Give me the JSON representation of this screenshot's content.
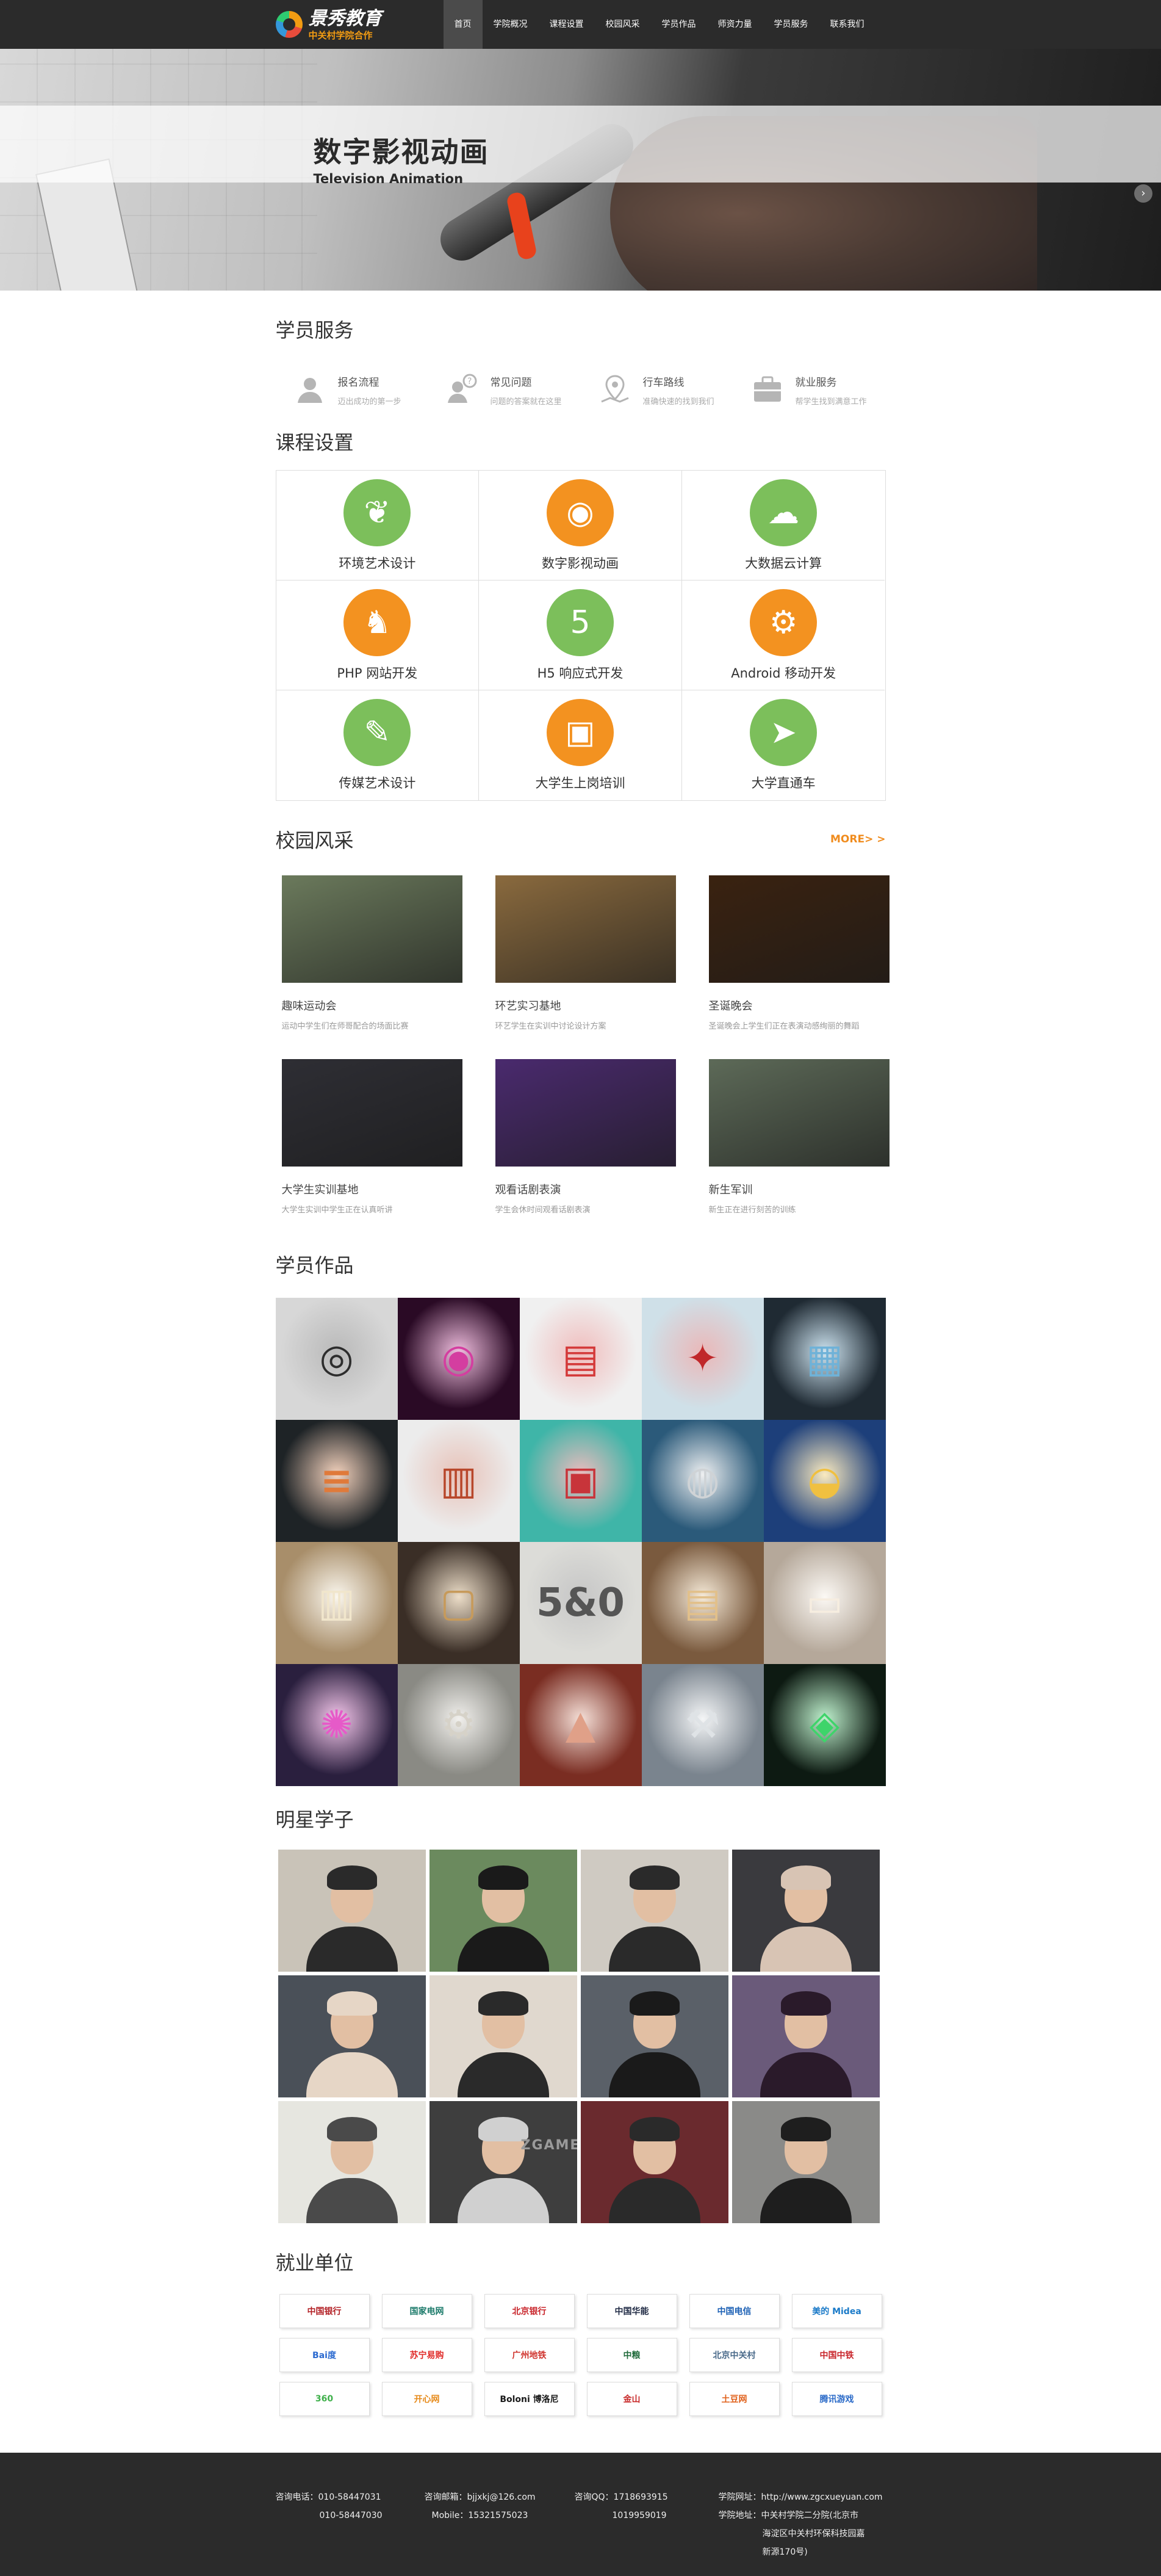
{
  "nav": {
    "logo_main": "景秀教育",
    "logo_sub": "中关村学院合作",
    "items": [
      "首页",
      "学院概况",
      "课程设置",
      "校园风采",
      "学员作品",
      "师资力量",
      "学员服务",
      "联系我们"
    ]
  },
  "banner": {
    "title": "数字影视动画",
    "subtitle": "Television Animation",
    "arrow": "›"
  },
  "services": {
    "title": "学员服务",
    "items": [
      {
        "title": "报名流程",
        "desc": "迈出成功的第一步",
        "icon": "user-icon"
      },
      {
        "title": "常见问题",
        "desc": "问题的答案就在这里",
        "icon": "question-icon"
      },
      {
        "title": "行车路线",
        "desc": "准确快速的找到我们",
        "icon": "map-pin-icon"
      },
      {
        "title": "就业服务",
        "desc": "帮学生找到满意工作",
        "icon": "briefcase-icon"
      }
    ]
  },
  "courses": {
    "title": "课程设置",
    "items": [
      {
        "label": "环境艺术设计",
        "glyph": "❦",
        "color": "#7cbf5b",
        "icon": "sprout-icon"
      },
      {
        "label": "数字影视动画",
        "glyph": "◉",
        "color": "#f39220",
        "icon": "film-reel-icon"
      },
      {
        "label": "大数据云计算",
        "glyph": "☁",
        "color": "#7cbf5b",
        "icon": "cloud-icon"
      },
      {
        "label": "PHP 网站开发",
        "glyph": "♞",
        "color": "#f39220",
        "icon": "elephant-icon"
      },
      {
        "label": "H5 响应式开发",
        "glyph": "5",
        "color": "#7cbf5b",
        "icon": "html5-icon"
      },
      {
        "label": "Android 移动开发",
        "glyph": "⚙",
        "color": "#f39220",
        "icon": "android-icon"
      },
      {
        "label": "传媒艺术设计",
        "glyph": "✎",
        "color": "#7cbf5b",
        "icon": "palette-icon"
      },
      {
        "label": "大学生上岗培训",
        "glyph": "▣",
        "color": "#f39220",
        "icon": "presentation-icon"
      },
      {
        "label": "大学直通车",
        "glyph": "➤",
        "color": "#7cbf5b",
        "icon": "train-icon"
      }
    ]
  },
  "campus": {
    "title": "校园风采",
    "more": "MORE> >",
    "items": [
      {
        "title": "趣味运动会",
        "desc": "运动中学生们在师哥配合的场面比赛",
        "bg": "#6b7a5c"
      },
      {
        "title": "环艺实习基地",
        "desc": "环艺学生在实训中讨论设计方案",
        "bg": "#8a6a3e"
      },
      {
        "title": "圣诞晚会",
        "desc": "圣诞晚会上学生们正在表演动感绚丽的舞蹈",
        "bg": "#3a2210"
      },
      {
        "title": "大学生实训基地",
        "desc": "大学生实训中学生正在认真听讲",
        "bg": "#2e2e34"
      },
      {
        "title": "观看话剧表演",
        "desc": "学生会休时间观看话剧表演",
        "bg": "#4a2a6e"
      },
      {
        "title": "新生军训",
        "desc": "新生正在进行刻苦的训练",
        "bg": "#5d6a58"
      }
    ]
  },
  "works": {
    "title": "学员作品",
    "tiles": [
      {
        "name": "camera-app-icon",
        "bg": "#d7d7d7",
        "fg": "#2d2d2d",
        "glyph": "◎"
      },
      {
        "name": "pink-robot-icon",
        "bg": "#2a0a25",
        "fg": "#d43ea0",
        "glyph": "◉"
      },
      {
        "name": "shopping-app-screens",
        "bg": "#f0f0f0",
        "fg": "#d43a3a",
        "glyph": "▤"
      },
      {
        "name": "bird-character",
        "bg": "#cfe0e8",
        "fg": "#c0282a",
        "glyph": "✦"
      },
      {
        "name": "dark-ui-kit",
        "bg": "#1f2a33",
        "fg": "#6fb2d8",
        "glyph": "▦"
      },
      {
        "name": "slider-ui-kit",
        "bg": "#1e2326",
        "fg": "#e07a3a",
        "glyph": "≡"
      },
      {
        "name": "food-app-screens",
        "bg": "#ececec",
        "fg": "#b8472b",
        "glyph": "▥"
      },
      {
        "name": "retro-bus-icon",
        "bg": "#3fb5a8",
        "fg": "#c8343a",
        "glyph": "▣"
      },
      {
        "name": "safe-box-icon",
        "bg": "#2b5a7a",
        "fg": "#cfd3d6",
        "glyph": "◍"
      },
      {
        "name": "blue-bag-icon",
        "bg": "#1d3f7a",
        "fg": "#f0c040",
        "glyph": "◒"
      },
      {
        "name": "library-interior",
        "bg": "#a88e6a",
        "fg": "#f1e6cc",
        "glyph": "▥"
      },
      {
        "name": "dark-lobby-interior",
        "bg": "#3a2e26",
        "fg": "#c79a5a",
        "glyph": "▢"
      },
      {
        "name": "white-office-interior",
        "bg": "#dcdcd8",
        "fg": "#555555",
        "glyph": "5&0"
      },
      {
        "name": "restaurant-interior",
        "bg": "#7a5a3e",
        "fg": "#e2c08a",
        "glyph": "▤"
      },
      {
        "name": "living-room-interior",
        "bg": "#b5a89a",
        "fg": "#f6ede0",
        "glyph": "▭"
      },
      {
        "name": "fantasy-city-render",
        "bg": "#2a1f3e",
        "fg": "#e65ac8",
        "glyph": "✺"
      },
      {
        "name": "robot-model-render",
        "bg": "#8a8a84",
        "fg": "#d6d2c8",
        "glyph": "⚙"
      },
      {
        "name": "mars-scene-render",
        "bg": "#7a2d22",
        "fg": "#e0a088",
        "glyph": "▲"
      },
      {
        "name": "mech-model-render",
        "bg": "#7a848e",
        "fg": "#dfe3e6",
        "glyph": "⚒"
      },
      {
        "name": "green-machine-render",
        "bg": "#0d1a12",
        "fg": "#3ed46a",
        "glyph": "◈"
      }
    ]
  },
  "stars": {
    "title": "明星学子",
    "photos": [
      {
        "bg": "#c9c3b8",
        "fg": "#2a2a2a"
      },
      {
        "bg": "#6b8a5e",
        "fg": "#1a1a1a"
      },
      {
        "bg": "#cfcac2",
        "fg": "#2a2a2a"
      },
      {
        "bg": "#3a3a3e",
        "fg": "#d8c4b4"
      },
      {
        "bg": "#4a5058",
        "fg": "#e6d6c6"
      },
      {
        "bg": "#e0d8ce",
        "fg": "#2a2a2a"
      },
      {
        "bg": "#5a6068",
        "fg": "#1a1a1a"
      },
      {
        "bg": "#6a5a7a",
        "fg": "#2a1a2a"
      },
      {
        "bg": "#e6e6e0",
        "fg": "#4a4a4a"
      },
      {
        "bg": "#3e3e3e",
        "fg": "#d0d0d0"
      },
      {
        "bg": "#6a2a2e",
        "fg": "#2a2a2a"
      },
      {
        "bg": "#8a8a88",
        "fg": "#1e1e1e"
      }
    ],
    "badge": "ZGAME"
  },
  "employers": {
    "title": "就业单位",
    "logos": [
      {
        "text": "中国银行",
        "color": "#b21f24"
      },
      {
        "text": "国家电网",
        "color": "#1b7a6a"
      },
      {
        "text": "北京银行",
        "color": "#c8242a"
      },
      {
        "text": "中国华能",
        "color": "#1f2a44"
      },
      {
        "text": "中国电信",
        "color": "#1a5fb4"
      },
      {
        "text": "美的 Midea",
        "color": "#1a7ac8"
      },
      {
        "text": "Bai度",
        "color": "#2b6ad0"
      },
      {
        "text": "苏宁易购",
        "color": "#e02a28"
      },
      {
        "text": "广州地铁",
        "color": "#d0342e"
      },
      {
        "text": "中粮",
        "color": "#1f6a3a"
      },
      {
        "text": "北京中关村",
        "color": "#4a6a8a"
      },
      {
        "text": "中国中铁",
        "color": "#c8242a"
      },
      {
        "text": "360",
        "color": "#3eb04a"
      },
      {
        "text": "开心网",
        "color": "#e68a1a"
      },
      {
        "text": "Boloni 博洛尼",
        "color": "#1a1a1a"
      },
      {
        "text": "金山",
        "color": "#c82a2a"
      },
      {
        "text": "土豆网",
        "color": "#e0601a"
      },
      {
        "text": "腾讯游戏",
        "color": "#2a6ac8"
      }
    ]
  },
  "footer": {
    "phone_label": "咨询电话：010-58447031",
    "phone_2": "010-58447030",
    "email_label": "咨询邮箱：bjjxkj@126.com",
    "mobile": "Mobile：15321575023",
    "qq_label": "咨询QQ：1718693915",
    "qq_2": "1019959019",
    "site_label": "学院网址：http://www.zgcxueyuan.com",
    "address_1": "学院地址：中关村学院二分院(北京市",
    "address_2": "海淀区中关村环保科技园嘉",
    "address_3": "新源170号)"
  }
}
